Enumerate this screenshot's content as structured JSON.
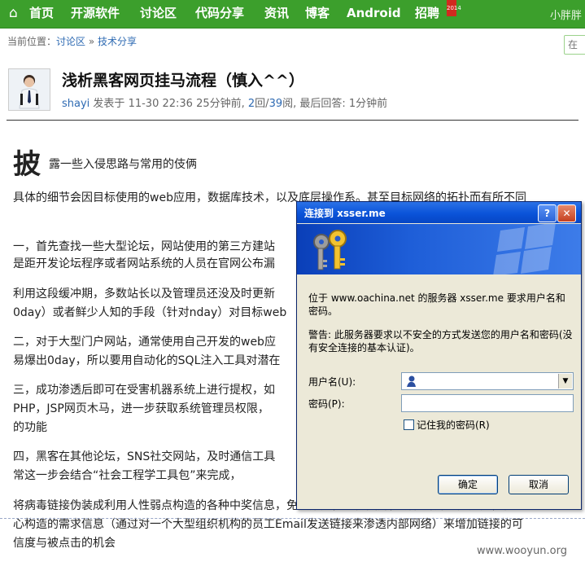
{
  "nav": {
    "items": [
      "首页",
      "开源软件",
      "讨论区",
      "代码分享",
      "资讯",
      "博客",
      "Android",
      "招聘"
    ],
    "badge": "2014",
    "user": "小胖胖"
  },
  "breadcrumb": {
    "prefix": "当前位置：",
    "crumb1": "讨论区",
    "sep": " » ",
    "crumb2": "技术分享"
  },
  "search": {
    "placeholder": "在"
  },
  "post": {
    "title": "浅析黑客网页挂马流程（慎入^^）",
    "author": "shayi",
    "posted_at_label": " 发表于 ",
    "date": "11-30 22:36",
    "ago": " 25分钟前, ",
    "replies": "2",
    "reply_label": "回/",
    "views": "39",
    "views_label": "阅, 最后回答: ",
    "last_reply": "1分钟前"
  },
  "article": {
    "drop_cap": "披",
    "lead": "露一些入侵思路与常用的伎俩",
    "p0": "具体的细节会因目标使用的web应用，数据库技术，以及底层操作系。甚至目标网络的拓扑而有所不同",
    "p1a": "一，首先查找一些大型论坛，网站使用的第三方建站",
    "p1b": "是距开发论坛程序或者网站系统的人员在官网公布漏",
    "p2a": "利用这段缓冲期，多数站长以及管理员还没及时更新",
    "p2b": "0day）或者鲜少人知的手段（针对nday）对目标web",
    "p3a": "二，对于大型门户网站，通常使用自己开发的web应",
    "p3b": "易爆出0day，所以要用自动化的SQL注入工具对潜在",
    "p4a": "三，成功渗透后即可在受害机器系统上进行提权，如",
    "p4b": "PHP，JSP网页木马，进一步获取系统管理员权限，",
    "p4c": "的功能",
    "p5a": "四，黑客在其他论坛，SNS社交网站，及时通信工具",
    "p5b": "常这一步会结合“社会工程学工具包”来完成，",
    "p6a": "将病毒链接伪装成利用人性弱点构造的各种中奖信息，免费赠送，色情图片，或者针对特定用户，精",
    "p6b": "心构造的需求信息（通过对一个大型组织机构的员工Email发送链接来渗透内部网络）来增加链接的可",
    "p6c": "信度与被点击的机会"
  },
  "dialog": {
    "title": "连接到 xsser.me",
    "help": "?",
    "close": "✕",
    "message": "位于 www.oachina.net 的服务器 xsser.me 要求用户名和密码。",
    "warning": "警告: 此服务器要求以不安全的方式发送您的用户名和密码(没有安全连接的基本认证)。",
    "username_label": "用户名(U):",
    "password_label": "密码(P):",
    "username_value": "",
    "password_value": "",
    "remember_label": "记住我的密码(R)",
    "ok": "确定",
    "cancel": "取消"
  },
  "watermark": "www.wooyun.org",
  "colors": {
    "nav_bg": "#3c9f2c",
    "link": "#2f6bb3",
    "dialog_title": "#0a53d9",
    "dialog_bg": "#ece9d8"
  }
}
